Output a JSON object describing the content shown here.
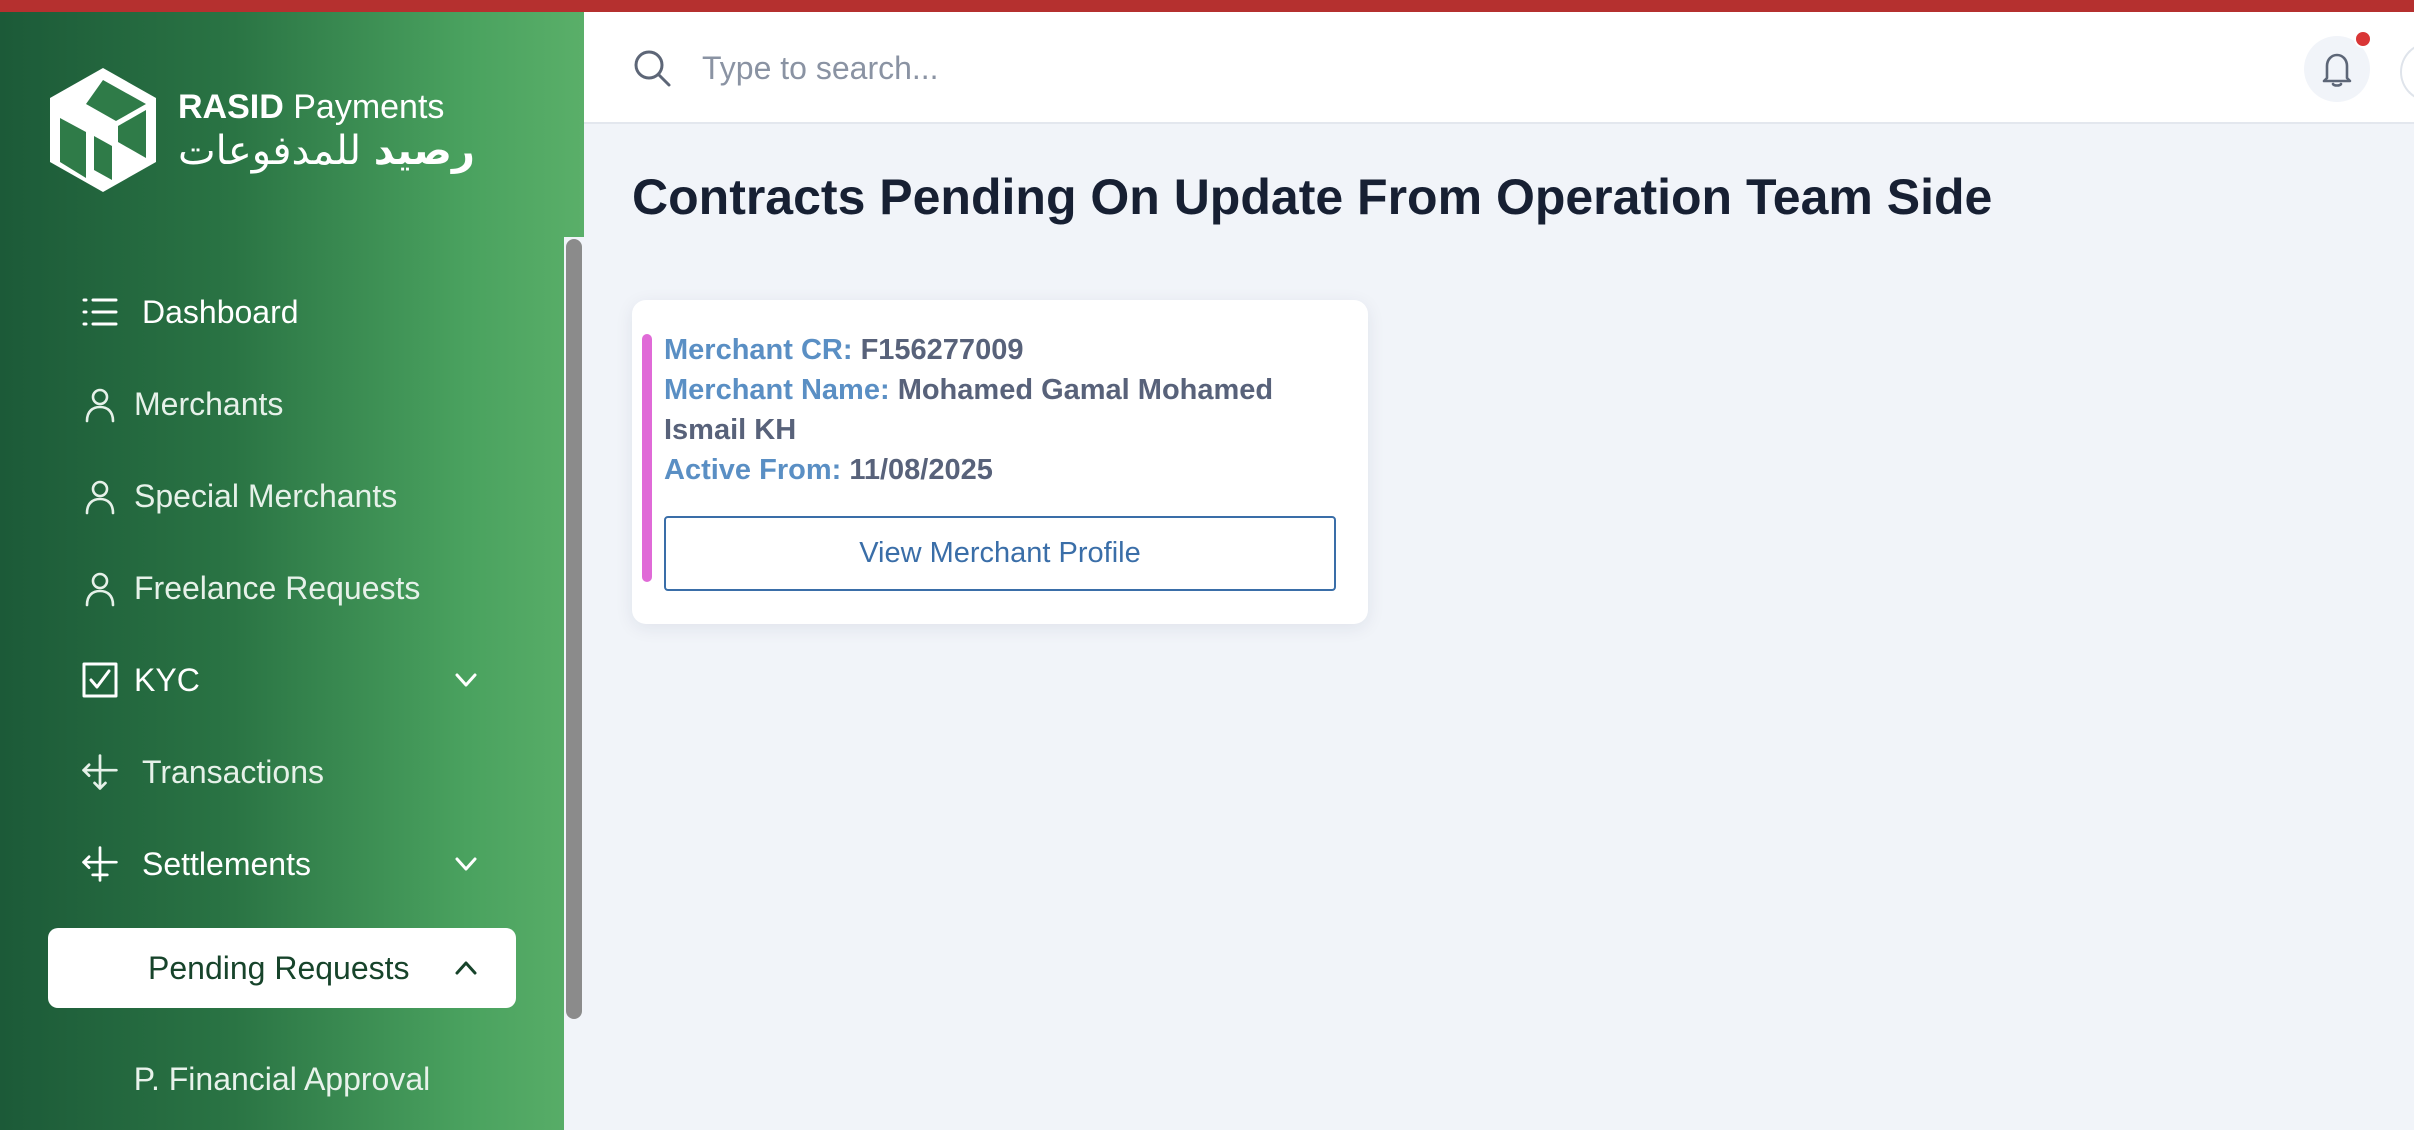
{
  "brand": {
    "name_bold": "RASID",
    "name_rest": " Payments",
    "arabic_bold": "رصيد",
    "arabic_rest": " للمدفوعات"
  },
  "colors": {
    "top_accent": "#b5302f",
    "sidebar_dark": "#1c5a38",
    "sidebar_light": "#5aaf69",
    "card_accent": "#e06ad7",
    "label_blue": "#5a8fc4",
    "button_blue": "#3a6ea8",
    "notification_dot": "#d93636"
  },
  "search": {
    "placeholder": "Type to search...",
    "icon": "search-icon"
  },
  "header": {
    "notification_icon": "bell-icon"
  },
  "sidebar": {
    "items": [
      {
        "label": "Dashboard",
        "icon": "list-icon"
      },
      {
        "label": "Merchants",
        "icon": "user-icon"
      },
      {
        "label": "Special Merchants",
        "icon": "user-icon"
      },
      {
        "label": "Freelance Requests",
        "icon": "user-icon"
      },
      {
        "label": "KYC",
        "icon": "checkbox-icon",
        "expandable": true
      },
      {
        "label": "Transactions",
        "icon": "transactions-icon"
      },
      {
        "label": "Settlements",
        "icon": "settlements-icon",
        "expandable": true
      },
      {
        "label": "Pending Requests",
        "expanded": true,
        "active": true
      }
    ],
    "sub_items": [
      {
        "label": "P. Financial Approval"
      }
    ]
  },
  "main": {
    "title": "Contracts Pending On Update From Operation Team Side",
    "cards": [
      {
        "cr_label": "Merchant CR:",
        "cr_value": "F156277009",
        "name_label": "Merchant Name:",
        "name_value": "Mohamed Gamal Mohamed Ismail KH",
        "active_label": "Active From:",
        "active_value": "11/08/2025",
        "button_label": "View Merchant Profile"
      }
    ]
  }
}
